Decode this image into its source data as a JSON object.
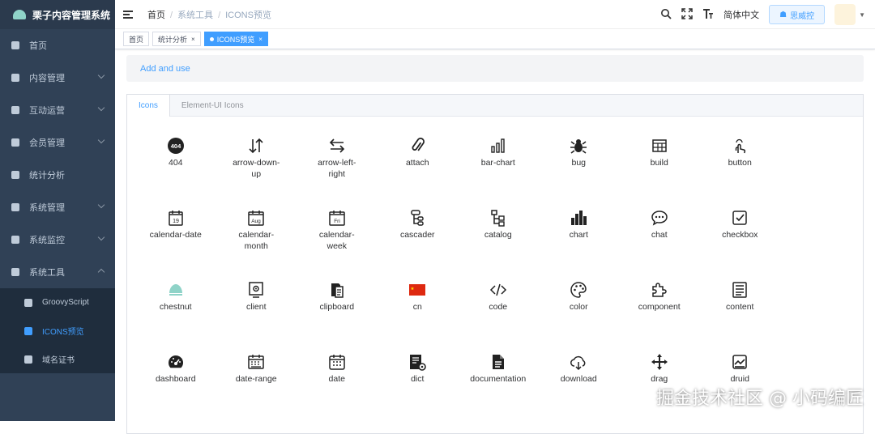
{
  "app": {
    "title": "栗子内容管理系统"
  },
  "sidebar": {
    "items": [
      {
        "label": "首页",
        "icon": "dashboard-icon"
      },
      {
        "label": "内容管理",
        "icon": "document-icon",
        "expandable": true
      },
      {
        "label": "互动运营",
        "icon": "gear-icon",
        "expandable": true
      },
      {
        "label": "会员管理",
        "icon": "users-icon",
        "expandable": true
      },
      {
        "label": "统计分析",
        "icon": "chart-icon"
      },
      {
        "label": "系统管理",
        "icon": "settings-icon",
        "expandable": true
      },
      {
        "label": "系统监控",
        "icon": "monitor-icon",
        "expandable": true
      },
      {
        "label": "系统工具",
        "icon": "toolbox-icon",
        "expandable": true,
        "expanded": true
      }
    ],
    "subitems": [
      {
        "label": "GroovyScript",
        "icon": "bug-icon"
      },
      {
        "label": "ICONS预览",
        "icon": "icons-icon",
        "active": true
      },
      {
        "label": "域名证书",
        "icon": "certificate-icon"
      }
    ]
  },
  "header": {
    "breadcrumb": [
      "首页",
      "系统工具",
      "ICONS预览"
    ],
    "language": "简体中文",
    "monitor_button": "思威控",
    "tools": [
      "search-icon",
      "fullscreen-icon",
      "font-size-icon"
    ]
  },
  "tags": [
    {
      "label": "首页"
    },
    {
      "label": "统计分析",
      "closable": true
    },
    {
      "label": "ICONS预览",
      "closable": true,
      "active": true
    }
  ],
  "banner": {
    "link": "Add and use"
  },
  "tabs": [
    {
      "label": "Icons",
      "active": true
    },
    {
      "label": "Element-UI Icons"
    }
  ],
  "icons": [
    {
      "name": "404"
    },
    {
      "name": "arrow-down-up"
    },
    {
      "name": "arrow-left-right"
    },
    {
      "name": "attach"
    },
    {
      "name": "bar-chart"
    },
    {
      "name": "bug"
    },
    {
      "name": "build"
    },
    {
      "name": "button"
    },
    {
      "name": "calendar-date"
    },
    {
      "name": "calendar-month"
    },
    {
      "name": "calendar-week"
    },
    {
      "name": "cascader"
    },
    {
      "name": "catalog"
    },
    {
      "name": "chart"
    },
    {
      "name": "chat"
    },
    {
      "name": "checkbox"
    },
    {
      "name": "chestnut"
    },
    {
      "name": "client"
    },
    {
      "name": "clipboard"
    },
    {
      "name": "cn"
    },
    {
      "name": "code"
    },
    {
      "name": "color"
    },
    {
      "name": "component"
    },
    {
      "name": "content"
    },
    {
      "name": "dashboard"
    },
    {
      "name": "date-range"
    },
    {
      "name": "date"
    },
    {
      "name": "dict"
    },
    {
      "name": "documentation"
    },
    {
      "name": "download"
    },
    {
      "name": "drag"
    },
    {
      "name": "druid"
    }
  ],
  "icon_glyph_text": {
    "calendar-date": "19",
    "calendar-month": "Aug",
    "calendar-week": "Fri",
    "404": "404"
  },
  "watermark": "掘金技术社区 @ 小码编匠"
}
